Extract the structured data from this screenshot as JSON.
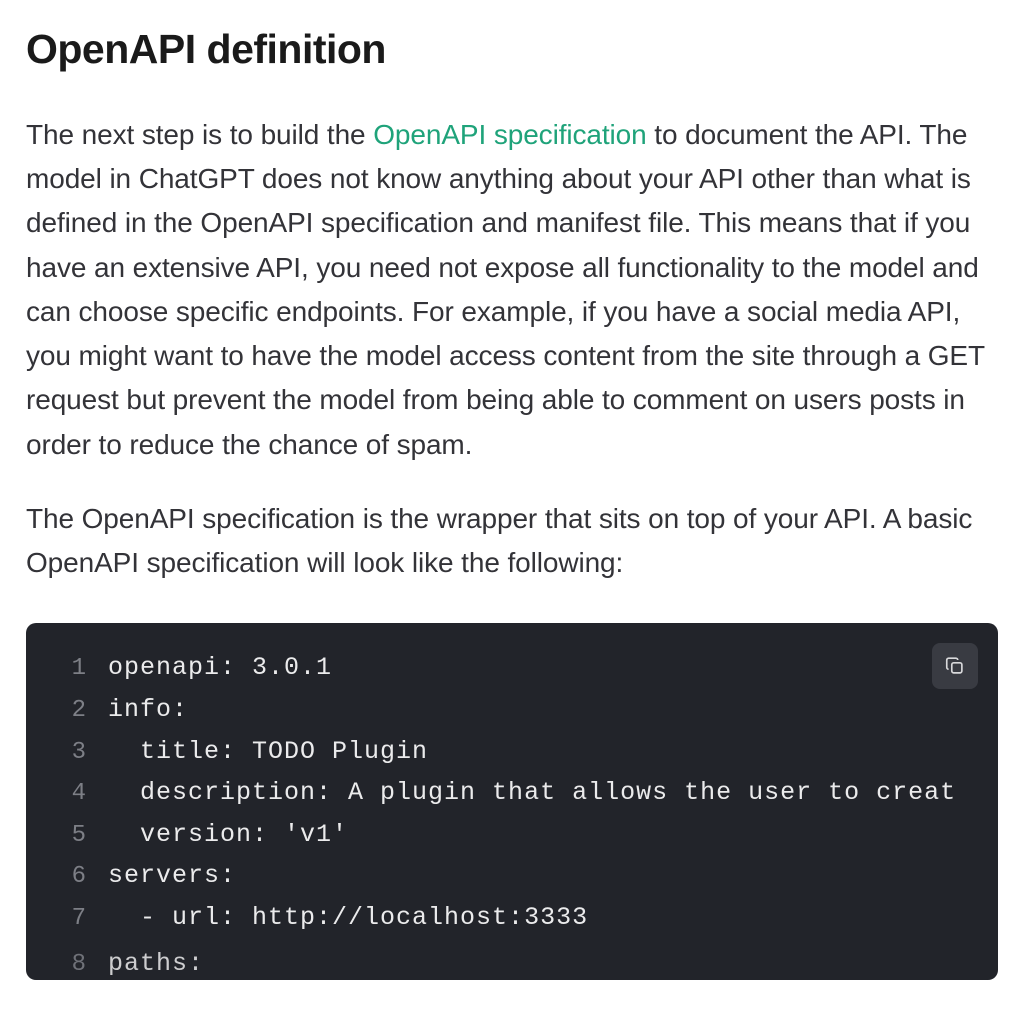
{
  "heading": "OpenAPI definition",
  "paragraph1": {
    "pre": "The next step is to build the ",
    "link": "OpenAPI specification",
    "post": " to document the API. The model in ChatGPT does not know anything about your API other than what is defined in the OpenAPI specification and manifest file. This means that if you have an extensive API, you need not expose all functionality to the model and can choose specific endpoints. For example, if you have a social media API, you might want to have the model access content from the site through a GET request but prevent the model from being able to comment on users posts in order to reduce the chance of spam."
  },
  "paragraph2": "The OpenAPI specification is the wrapper that sits on top of your API. A basic OpenAPI specification will look like the following:",
  "code": {
    "lines": [
      {
        "n": "1",
        "t": "openapi: 3.0.1"
      },
      {
        "n": "2",
        "t": "info:"
      },
      {
        "n": "3",
        "t": "  title: TODO Plugin"
      },
      {
        "n": "4",
        "t": "  description: A plugin that allows the user to creat"
      },
      {
        "n": "5",
        "t": "  version: 'v1'"
      },
      {
        "n": "6",
        "t": "servers:"
      },
      {
        "n": "7",
        "t": "  - url: http://localhost:3333"
      },
      {
        "n": "8",
        "t": "paths:"
      }
    ]
  },
  "copy_label": "Copy"
}
